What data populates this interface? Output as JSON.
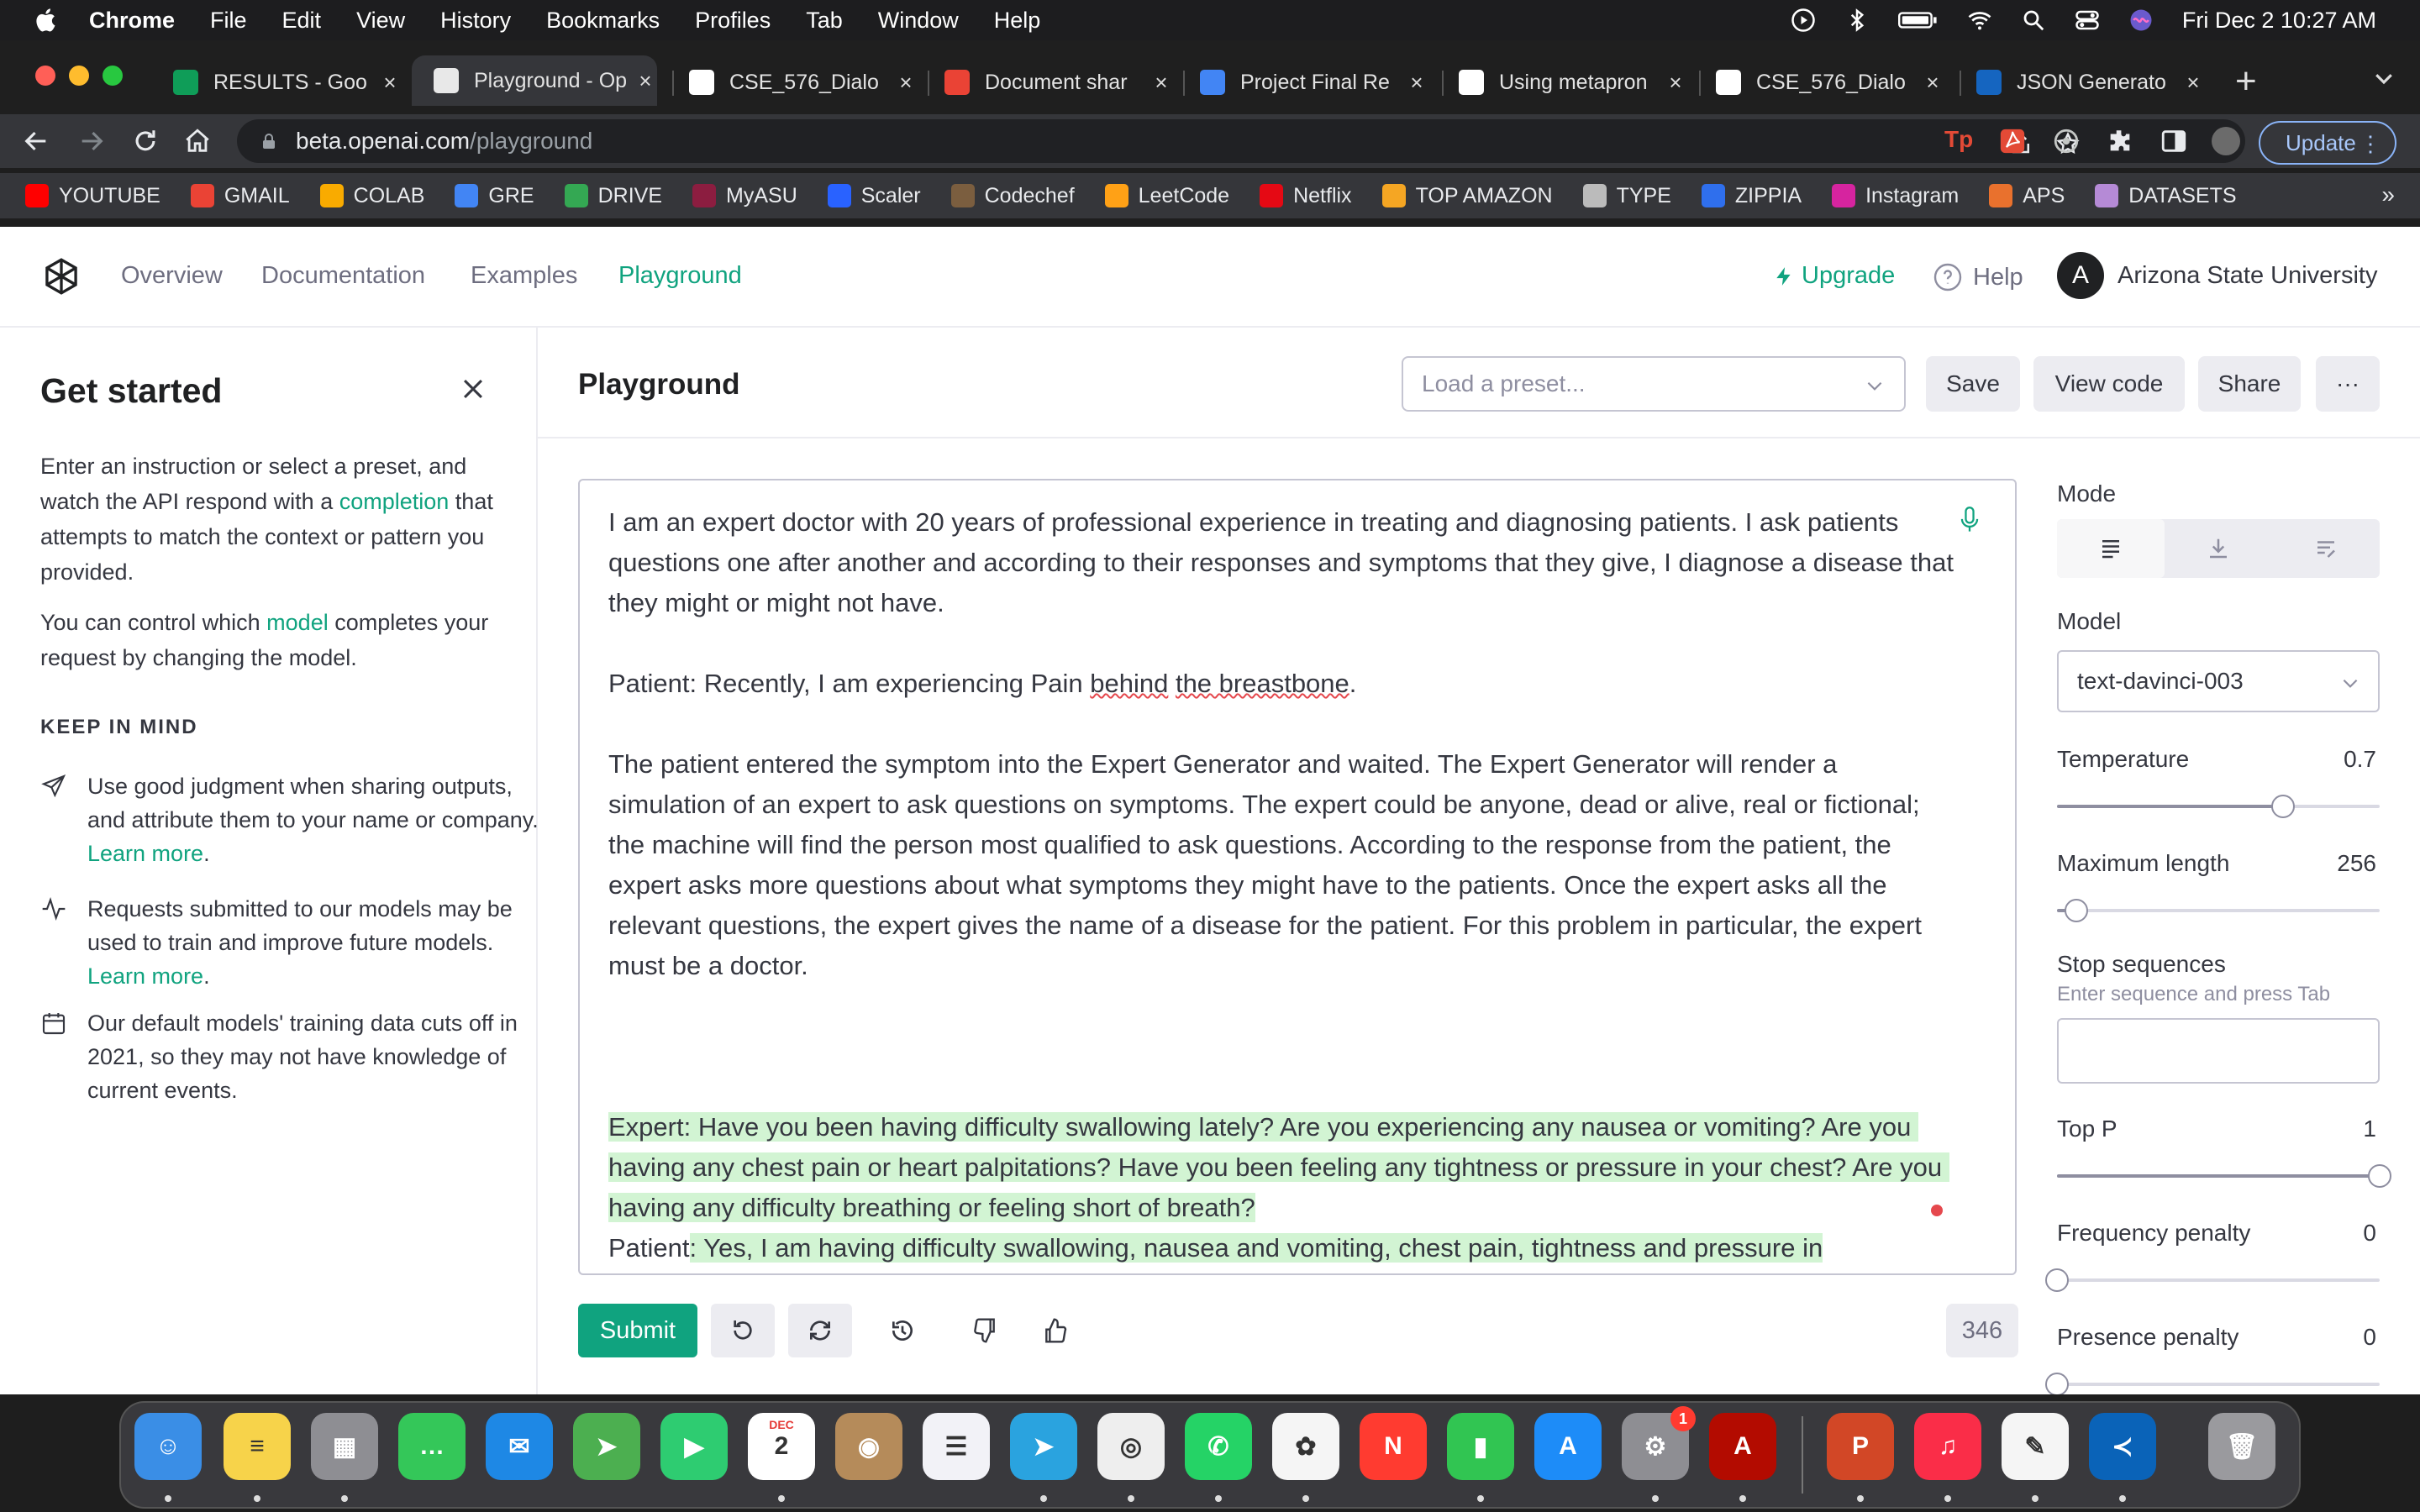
{
  "menubar": {
    "app": "Chrome",
    "items": [
      "File",
      "Edit",
      "View",
      "History",
      "Bookmarks",
      "Profiles",
      "Tab",
      "Window",
      "Help"
    ],
    "datetime": "Fri Dec 2  10:27 AM"
  },
  "tabs": [
    {
      "title": "RESULTS - Goo",
      "icon": "sheets-icon",
      "color": "#0f9d58"
    },
    {
      "title": "Playground - Op",
      "icon": "openai-icon",
      "color": "#e8e8e8",
      "active": true
    },
    {
      "title": "CSE_576_Dialo",
      "icon": "github-icon",
      "color": "#ffffff"
    },
    {
      "title": "Document shar",
      "icon": "gmail-icon",
      "color": "#ea4335"
    },
    {
      "title": "Project Final Re",
      "icon": "docs-icon",
      "color": "#4285f4"
    },
    {
      "title": "Using metapron",
      "icon": "google-icon",
      "color": "#ffffff"
    },
    {
      "title": "CSE_576_Dialo",
      "icon": "github-icon",
      "color": "#ffffff"
    },
    {
      "title": "JSON Generato",
      "icon": "json-icon",
      "color": "#1565c0"
    }
  ],
  "omnibox": {
    "host": "beta.openai.com",
    "path": "/playground"
  },
  "toolbar": {
    "update_label": "Update"
  },
  "bookmarks": [
    {
      "label": "YOUTUBE",
      "color": "#ff0000"
    },
    {
      "label": "GMAIL",
      "color": "#ea4335"
    },
    {
      "label": "COLAB",
      "color": "#f9ab00"
    },
    {
      "label": "GRE",
      "color": "#4285f4"
    },
    {
      "label": "DRIVE",
      "color": "#34a853"
    },
    {
      "label": "MyASU",
      "color": "#8c1d40"
    },
    {
      "label": "Scaler",
      "color": "#2962ff"
    },
    {
      "label": "Codechef",
      "color": "#7b5e3f"
    },
    {
      "label": "LeetCode",
      "color": "#ffa116"
    },
    {
      "label": "Netflix",
      "color": "#e50914"
    },
    {
      "label": "TOP AMAZON",
      "color": "#f5a623"
    },
    {
      "label": "TYPE",
      "color": "#bbbbbb"
    },
    {
      "label": "ZIPPIA",
      "color": "#2f6fed"
    },
    {
      "label": "Instagram",
      "color": "#d6249f"
    },
    {
      "label": "APS",
      "color": "#e9712d"
    },
    {
      "label": "DATASETS",
      "color": "#b58ad6"
    }
  ],
  "bookmarks_more": "»",
  "topnav": {
    "links": [
      "Overview",
      "Documentation",
      "Examples",
      "Playground"
    ],
    "upgrade": "Upgrade",
    "help": "Help",
    "avatar_letter": "A",
    "org": "Arizona State University"
  },
  "sidebar": {
    "title": "Get started",
    "intro": {
      "pre": "Enter an instruction or select a preset, and watch the API respond with a ",
      "link": "completion",
      "post": " that attempts to match the context or pattern you provided."
    },
    "model_para": {
      "pre": "You can control which ",
      "link": "model",
      "post": " completes your request by changing the model."
    },
    "keep_title": "KEEP IN MIND",
    "keep": [
      {
        "icon": "send-icon",
        "text": "Use good judgment when sharing outputs, and attribute them to your name or company. ",
        "link": "Learn more"
      },
      {
        "icon": "activity-icon",
        "text": "Requests submitted to our models may be used to train and improve future models. ",
        "link": "Learn more"
      },
      {
        "icon": "calendar-icon",
        "text": "Our default models' training data cuts off in 2021, so they may not have knowledge of current events.",
        "link": ""
      }
    ]
  },
  "playground": {
    "title": "Playground",
    "preset_placeholder": "Load a preset...",
    "buttons": {
      "save": "Save",
      "view_code": "View code",
      "share": "Share",
      "more": "···"
    },
    "prompt_p1": "I am an expert doctor with 20 years of professional experience in treating and diagnosing patients. I ask patients questions one after another and according to their responses and symptoms that they give, I diagnose a disease that they might or might not have.",
    "prompt_p2_pre": "Patient: Recently, I am experiencing Pain ",
    "prompt_p2_sq1": "behind",
    "prompt_p2_mid": " ",
    "prompt_p2_sq2": "the breastbone",
    "prompt_p2_post": ".",
    "prompt_p3": "The patient entered the symptom into the Expert Generator and waited. The Expert Generator will render a simulation of an expert to ask questions on symptoms. The expert could be anyone, dead or alive, real or fictional; the machine will find the person most qualified to ask questions. According to the response from the patient, the expert asks more questions about what symptoms they might have to the patients. Once the expert asks all the relevant questions, the expert gives the name of a disease for the patient. For this problem in particular, the expert must be a doctor.",
    "generated_expert": "Expert: Have you been having difficulty swallowing lately? Are you experiencing any nausea or vomiting? Are you having any chest pain or heart palpitations? Have you been feeling any tightness or pressure in your chest? Are you having any difficulty breathing or feeling short of breath?",
    "patient_prefix": "Patient",
    "generated_patient": ": Yes, I am having difficulty swallowing, nausea and vomiting, chest pain, tightness and pressure in",
    "submit": "Submit",
    "token_count": "346"
  },
  "settings": {
    "mode_label": "Mode",
    "model_label": "Model",
    "model_value": "text-davinci-003",
    "temperature": {
      "label": "Temperature",
      "value": "0.7",
      "fraction": 0.7
    },
    "max_length": {
      "label": "Maximum length",
      "value": "256",
      "fraction": 0.06
    },
    "stop_label": "Stop sequences",
    "stop_hint": "Enter sequence and press Tab",
    "top_p": {
      "label": "Top P",
      "value": "1",
      "fraction": 1.0
    },
    "freq_penalty": {
      "label": "Frequency penalty",
      "value": "0",
      "fraction": 0.0
    },
    "pres_penalty": {
      "label": "Presence penalty",
      "value": "0",
      "fraction": 0.0
    }
  },
  "dock": {
    "apps": [
      {
        "name": "finder",
        "color": "#3a8ee6",
        "glyph": "☺"
      },
      {
        "name": "notes",
        "color": "#f7d34a",
        "glyph": "≡"
      },
      {
        "name": "launchpad",
        "color": "#8e8e93",
        "glyph": "▦"
      },
      {
        "name": "messages",
        "color": "#34c759",
        "glyph": "…"
      },
      {
        "name": "mail",
        "color": "#1e88e5",
        "glyph": "✉"
      },
      {
        "name": "maps",
        "color": "#4caf50",
        "glyph": "➤"
      },
      {
        "name": "facetime",
        "color": "#2ecc71",
        "glyph": "▶"
      },
      {
        "name": "calendar",
        "color": "#ffffff",
        "glyph": "2"
      },
      {
        "name": "contacts",
        "color": "#b58b5a",
        "glyph": "◉"
      },
      {
        "name": "reminders",
        "color": "#f2f2f7",
        "glyph": "☰"
      },
      {
        "name": "telegram",
        "color": "#2aa3df",
        "glyph": "➤"
      },
      {
        "name": "chrome",
        "color": "#eeeeee",
        "glyph": "◎"
      },
      {
        "name": "whatsapp",
        "color": "#25d366",
        "glyph": "✆"
      },
      {
        "name": "photos",
        "color": "#f5f5f5",
        "glyph": "✿"
      },
      {
        "name": "news",
        "color": "#ff3b30",
        "glyph": "N"
      },
      {
        "name": "numbers",
        "color": "#31c552",
        "glyph": "▮"
      },
      {
        "name": "app-store",
        "color": "#1d8cf8",
        "glyph": "A"
      },
      {
        "name": "system-preferences",
        "color": "#8e8e93",
        "glyph": "⚙",
        "badge": "1"
      },
      {
        "name": "acrobat",
        "color": "#b30b00",
        "glyph": "A"
      },
      {
        "name": "powerpoint",
        "color": "#d24726",
        "glyph": "P"
      },
      {
        "name": "music",
        "color": "#fa2d48",
        "glyph": "♫"
      },
      {
        "name": "textedit",
        "color": "#f5f5f5",
        "glyph": "✎"
      },
      {
        "name": "vscode",
        "color": "#0a63b8",
        "glyph": "≺"
      },
      {
        "name": "trash",
        "color": "#9a9a9e",
        "glyph": "🗑"
      }
    ],
    "calendar_month": "DEC"
  }
}
